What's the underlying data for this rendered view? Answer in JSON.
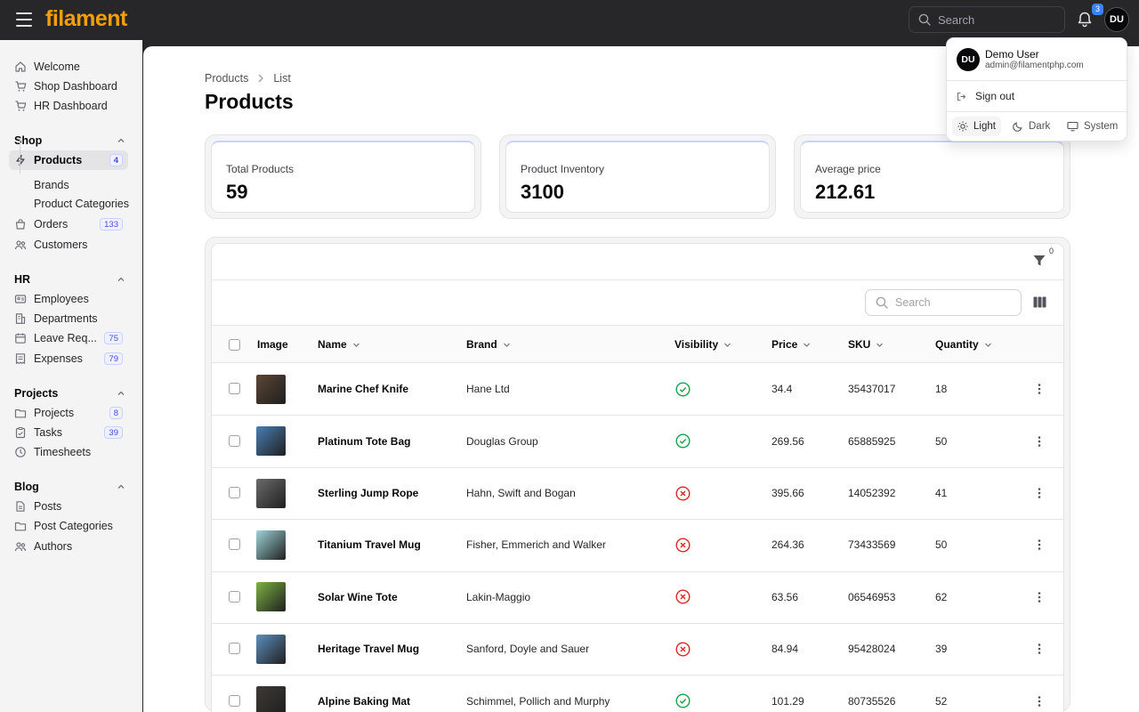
{
  "topbar": {
    "logo": "filament",
    "search_placeholder": "Search",
    "notifications_count": "3",
    "avatar_initials": "DU"
  },
  "sidebar": {
    "top_items": [
      {
        "label": "Welcome",
        "icon": "home-icon"
      },
      {
        "label": "Shop Dashboard",
        "icon": "cart-icon"
      },
      {
        "label": "HR Dashboard",
        "icon": "cart-icon"
      }
    ],
    "groups": {
      "shop": {
        "label": "Shop",
        "items": [
          {
            "label": "Products",
            "badge": "4",
            "icon": "bolt-icon"
          },
          {
            "label": "Brands"
          },
          {
            "label": "Product Categories"
          },
          {
            "label": "Orders",
            "badge": "133",
            "icon": "shopping-bag-icon"
          },
          {
            "label": "Customers",
            "icon": "users-icon"
          }
        ]
      },
      "hr": {
        "label": "HR",
        "items": [
          {
            "label": "Employees",
            "icon": "id-card-icon"
          },
          {
            "label": "Departments",
            "icon": "building-icon"
          },
          {
            "label": "Leave Req...",
            "badge": "75",
            "icon": "calendar-icon"
          },
          {
            "label": "Expenses",
            "badge": "79",
            "icon": "receipt-icon"
          }
        ]
      },
      "projects": {
        "label": "Projects",
        "items": [
          {
            "label": "Projects",
            "badge": "8",
            "icon": "folder-icon"
          },
          {
            "label": "Tasks",
            "badge": "39",
            "icon": "clipboard-icon"
          },
          {
            "label": "Timesheets",
            "icon": "clock-icon"
          }
        ]
      },
      "blog": {
        "label": "Blog",
        "items": [
          {
            "label": "Posts",
            "icon": "document-icon"
          },
          {
            "label": "Post Categories",
            "icon": "folder-icon"
          },
          {
            "label": "Authors",
            "icon": "users-icon"
          }
        ]
      }
    }
  },
  "breadcrumb": {
    "root": "Products",
    "current": "List"
  },
  "page": {
    "title": "Products"
  },
  "stats": [
    {
      "label": "Total Products",
      "value": "59"
    },
    {
      "label": "Product Inventory",
      "value": "3100"
    },
    {
      "label": "Average price",
      "value": "212.61"
    }
  ],
  "table": {
    "filter_count": "0",
    "search_placeholder": "Search",
    "columns": {
      "image": "Image",
      "name": "Name",
      "brand": "Brand",
      "visibility": "Visibility",
      "price": "Price",
      "sku": "SKU",
      "quantity": "Quantity"
    },
    "rows": [
      {
        "name": "Marine Chef Knife",
        "brand": "Hane Ltd",
        "visible": true,
        "price": "34.4",
        "sku": "35437017",
        "quantity": "18",
        "thumb_color": "#5b4636"
      },
      {
        "name": "Platinum Tote Bag",
        "brand": "Douglas Group",
        "visible": true,
        "price": "269.56",
        "sku": "65885925",
        "quantity": "50",
        "thumb_color": "#4a7fb5"
      },
      {
        "name": "Sterling Jump Rope",
        "brand": "Hahn, Swift and Bogan",
        "visible": false,
        "price": "395.66",
        "sku": "14052392",
        "quantity": "41",
        "thumb_color": "#6b6b6b"
      },
      {
        "name": "Titanium Travel Mug",
        "brand": "Fisher, Emmerich and Walker",
        "visible": false,
        "price": "264.36",
        "sku": "73433569",
        "quantity": "50",
        "thumb_color": "#9ed4d8"
      },
      {
        "name": "Solar Wine Tote",
        "brand": "Lakin-Maggio",
        "visible": false,
        "price": "63.56",
        "sku": "06546953",
        "quantity": "62",
        "thumb_color": "#7cb342"
      },
      {
        "name": "Heritage Travel Mug",
        "brand": "Sanford, Doyle and Sauer",
        "visible": false,
        "price": "84.94",
        "sku": "95428024",
        "quantity": "39",
        "thumb_color": "#5e8fbf"
      },
      {
        "name": "Alpine Baking Mat",
        "brand": "Schimmel, Pollich and Murphy",
        "visible": true,
        "price": "101.29",
        "sku": "80735526",
        "quantity": "52",
        "thumb_color": "#3e3a35"
      }
    ]
  },
  "user_menu": {
    "initials": "DU",
    "name": "Demo User",
    "email": "admin@filamentphp.com",
    "sign_out": "Sign out",
    "themes": {
      "light": "Light",
      "dark": "Dark",
      "system": "System"
    },
    "selected_theme": "Light"
  },
  "colors": {
    "brand": "#f59e0b",
    "visible_ok": "#16a34a",
    "visible_no": "#dc2626",
    "badge": "#4f46e5"
  }
}
